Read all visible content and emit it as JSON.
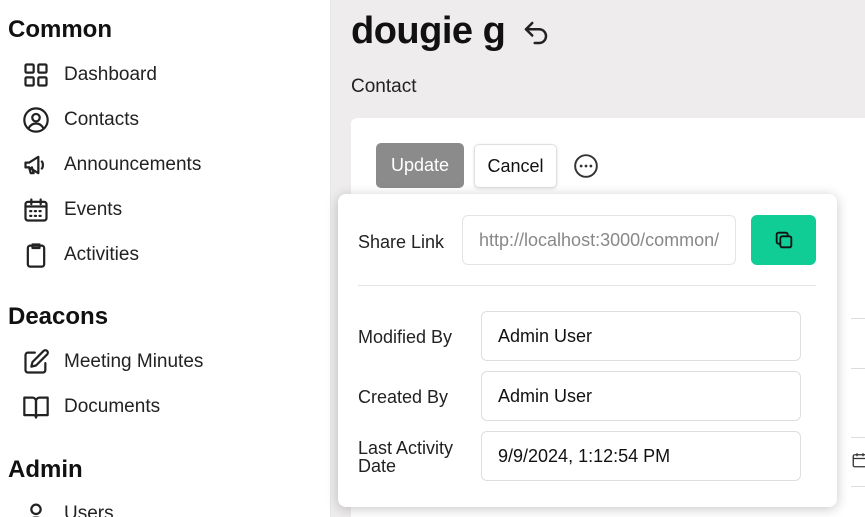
{
  "sidebar": {
    "sections": [
      {
        "title": "Common",
        "items": [
          {
            "label": "Dashboard",
            "icon": "dashboard-icon"
          },
          {
            "label": "Contacts",
            "icon": "user-circle-icon"
          },
          {
            "label": "Announcements",
            "icon": "megaphone-icon"
          },
          {
            "label": "Events",
            "icon": "calendar-icon"
          },
          {
            "label": "Activities",
            "icon": "clipboard-icon"
          }
        ]
      },
      {
        "title": "Deacons",
        "items": [
          {
            "label": "Meeting Minutes",
            "icon": "edit-icon"
          },
          {
            "label": "Documents",
            "icon": "book-icon"
          }
        ]
      },
      {
        "title": "Admin",
        "items": [
          {
            "label": "Users",
            "icon": "user-icon"
          }
        ]
      }
    ]
  },
  "header": {
    "title": "dougie g",
    "subtitle": "Contact"
  },
  "actions": {
    "update_label": "Update",
    "cancel_label": "Cancel"
  },
  "popover": {
    "share_label": "Share Link",
    "share_value": "http://localhost:3000/common/",
    "modified_by_label": "Modified By",
    "modified_by_value": "Admin User",
    "created_by_label": "Created By",
    "created_by_value": "Admin User",
    "last_activity_label_line1": "Last Activity",
    "last_activity_label_line2": "Date",
    "last_activity_value": "9/9/2024, 1:12:54 PM"
  },
  "colors": {
    "copy_button": "#10cc95",
    "update_button": "#8b8b8b",
    "main_background": "#eeeced"
  }
}
